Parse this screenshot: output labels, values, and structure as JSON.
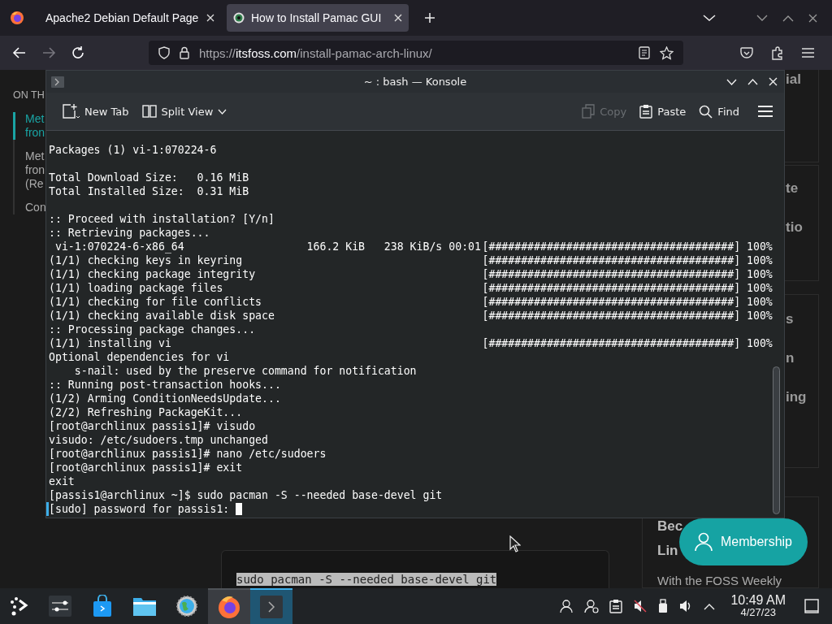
{
  "browser": {
    "tabs": [
      {
        "title": "Apache2 Debian Default Page",
        "selected": false
      },
      {
        "title": "How to Install Pamac GUI",
        "selected": true
      }
    ],
    "nav_buttons": [
      {
        "kind": "back",
        "disabled": false
      },
      {
        "kind": "forward",
        "disabled": true
      },
      {
        "kind": "reload",
        "disabled": false
      }
    ],
    "url": {
      "scheme": "https://",
      "host": "itsfoss.com",
      "path": "/install-pamac-arch-linux/"
    }
  },
  "page": {
    "toc": {
      "heading": "ON TH",
      "items": [
        {
          "lines": [
            "Met",
            "fron"
          ],
          "selected": true
        },
        {
          "lines": [
            "Met",
            "fron",
            "(Re"
          ],
          "selected": false
        },
        {
          "lines": [
            "Con"
          ],
          "selected": false
        }
      ]
    },
    "code": "sudo pacman -S --needed base-devel git",
    "sidebar_cards": [
      [
        "ial"
      ],
      [
        "te",
        "tio"
      ],
      [
        "s",
        "n",
        "ing"
      ]
    ],
    "newsletter": {
      "title_lines": [
        "Bec",
        "Lin"
      ],
      "text": "With the FOSS Weekly"
    },
    "membership_button": "Membership"
  },
  "konsole": {
    "title": "~ : bash — Konsole",
    "toolbar": [
      {
        "kind": "new-tab",
        "label": "New Tab",
        "disabled": false
      },
      {
        "kind": "split-view",
        "label": "Split View",
        "disabled": false
      },
      {
        "kind": "copy",
        "label": "Copy",
        "disabled": true
      },
      {
        "kind": "paste",
        "label": "Paste",
        "disabled": false
      },
      {
        "kind": "find",
        "label": "Find",
        "disabled": false
      }
    ],
    "output": [
      [
        {
          "text": "Packages (1) vi-1:070224-6"
        }
      ],
      [
        {
          "text": "Total Download Size:   0.16 MiB"
        },
        {
          "text": "Total Installed Size:  0.31 MiB"
        }
      ],
      [
        {
          "text": ":: Proceed with installation? [Y/n]"
        },
        {
          "text": ":: Retrieving packages..."
        },
        {
          "text": " vi-1:070224-6-x86_64                   166.2 KiB   238 KiB/s 00:01",
          "bar": "[######################################] 100%"
        },
        {
          "text": "(1/1) checking keys in keyring",
          "bar": "[######################################] 100%"
        },
        {
          "text": "(1/1) checking package integrity",
          "bar": "[######################################] 100%"
        },
        {
          "text": "(1/1) loading package files",
          "bar": "[######################################] 100%"
        },
        {
          "text": "(1/1) checking for file conflicts",
          "bar": "[######################################] 100%"
        },
        {
          "text": "(1/1) checking available disk space",
          "bar": "[######################################] 100%"
        },
        {
          "text": ":: Processing package changes..."
        },
        {
          "text": "(1/1) installing vi",
          "bar": "[######################################] 100%"
        },
        {
          "text": "Optional dependencies for vi"
        },
        {
          "text": "    s-nail: used by the preserve command for notification"
        },
        {
          "text": ":: Running post-transaction hooks..."
        },
        {
          "text": "(1/2) Arming ConditionNeedsUpdate..."
        },
        {
          "text": "(2/2) Refreshing PackageKit..."
        },
        {
          "text": "[root@archlinux passis1]# visudo"
        },
        {
          "text": "visudo: /etc/sudoers.tmp unchanged"
        },
        {
          "text": "[root@archlinux passis1]# nano /etc/sudoers"
        },
        {
          "text": "[root@archlinux passis1]# exit"
        },
        {
          "text": "exit"
        },
        {
          "text": "[passis1@archlinux ~]$ sudo pacman -S --needed base-devel git"
        }
      ]
    ],
    "prompt_line": {
      "text": "[sudo] password for passis1:",
      "cursor": true
    }
  },
  "taskbar": {
    "apps": [
      {
        "kind": "sliders",
        "open": false,
        "active": false
      },
      {
        "kind": "store",
        "open": false,
        "active": false
      },
      {
        "kind": "folder",
        "open": false,
        "active": false
      },
      {
        "kind": "globe",
        "open": false,
        "active": false
      },
      {
        "kind": "firefox",
        "open": true,
        "active": false
      },
      {
        "kind": "terminal",
        "open": true,
        "active": true
      }
    ],
    "clock": {
      "time": "10:49 AM",
      "date": "4/27/23"
    }
  }
}
